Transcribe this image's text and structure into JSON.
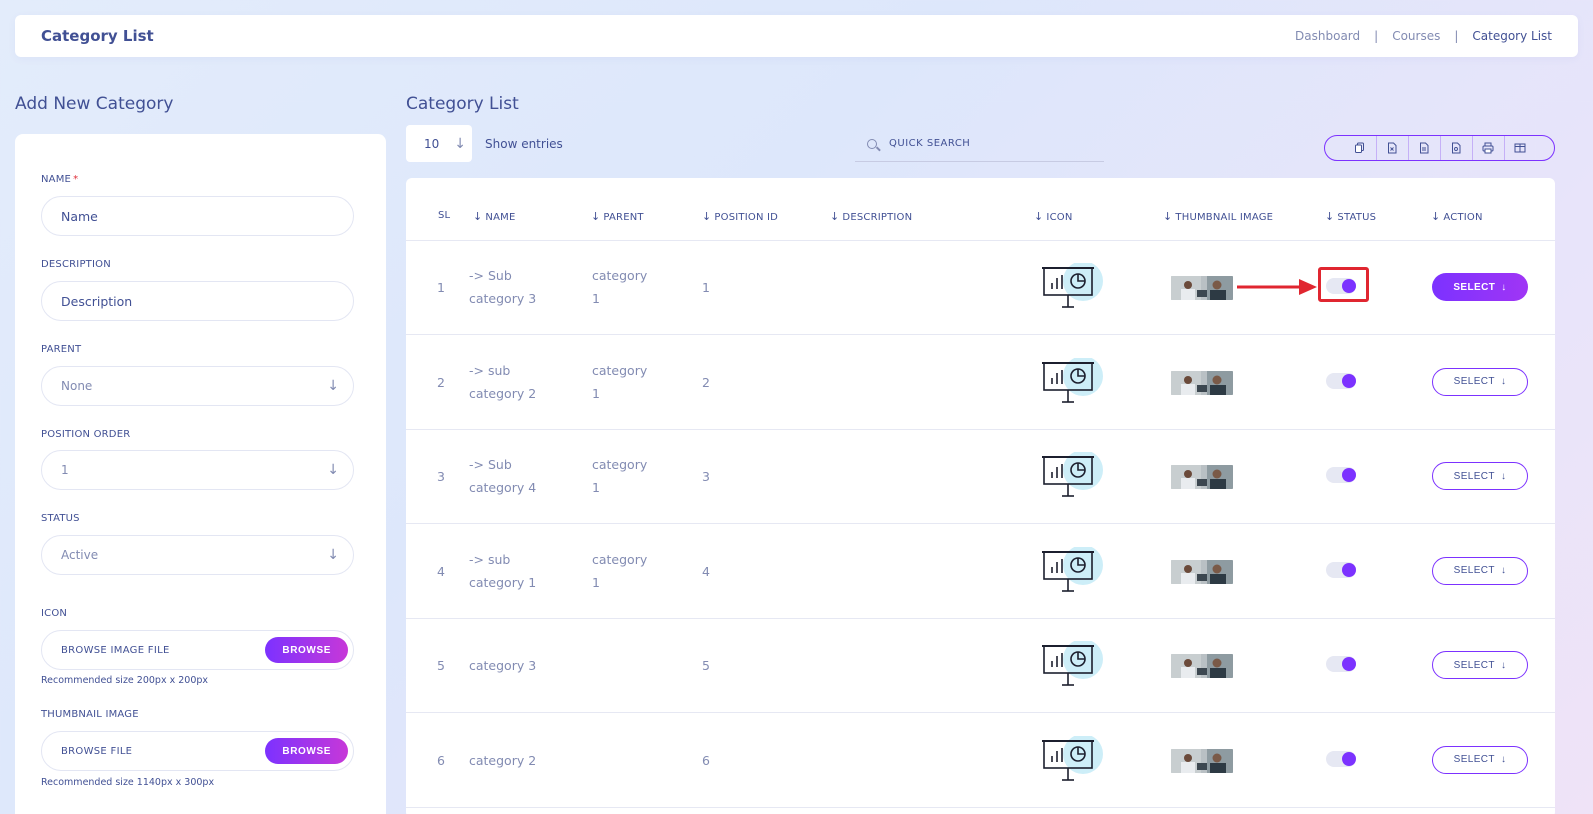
{
  "header": {
    "title": "Category List",
    "breadcrumb": [
      "Dashboard",
      "Courses",
      "Category List"
    ],
    "separator": "|"
  },
  "form": {
    "heading": "Add New Category",
    "name_label": "NAME",
    "name_required": "*",
    "name_placeholder": "Name",
    "description_label": "DESCRIPTION",
    "description_placeholder": "Description",
    "parent_label": "PARENT",
    "parent_value": "None",
    "position_label": "POSITION ORDER",
    "position_value": "1",
    "status_label": "STATUS",
    "status_value": "Active",
    "icon_label": "ICON",
    "icon_file_text": "BROWSE IMAGE FILE",
    "icon_browse": "BROWSE",
    "icon_hint": "Recommended size 200px x 200px",
    "thumb_label": "THUMBNAIL IMAGE",
    "thumb_file_text": "BROWSE FILE",
    "thumb_browse": "BROWSE",
    "thumb_hint": "Recommended size 1140px x 300px"
  },
  "list": {
    "heading": "Category List",
    "entries_value": "10",
    "entries_label": "Show entries",
    "search_placeholder": "QUICK SEARCH",
    "export_icons": [
      "copy-icon",
      "excel-icon",
      "csv-icon",
      "pdf-icon",
      "print-icon",
      "columns-icon"
    ],
    "columns": [
      "SL",
      "NAME",
      "PARENT",
      "POSITION ID",
      "DESCRIPTION",
      "ICON",
      "THUMBNAIL IMAGE",
      "STATUS",
      "ACTION"
    ],
    "rows": [
      {
        "sl": "1",
        "name1": "-> Sub",
        "name2": "category 3",
        "parent1": "category",
        "parent2": "1",
        "pos": "1",
        "desc": "",
        "action": "SELECT"
      },
      {
        "sl": "2",
        "name1": "-> sub",
        "name2": "category 2",
        "parent1": "category",
        "parent2": "1",
        "pos": "2",
        "desc": "",
        "action": "SELECT"
      },
      {
        "sl": "3",
        "name1": "-> Sub",
        "name2": "category 4",
        "parent1": "category",
        "parent2": "1",
        "pos": "3",
        "desc": "",
        "action": "SELECT"
      },
      {
        "sl": "4",
        "name1": "-> sub",
        "name2": "category 1",
        "parent1": "category",
        "parent2": "1",
        "pos": "4",
        "desc": "",
        "action": "SELECT"
      },
      {
        "sl": "5",
        "name1": "category 3",
        "name2": "",
        "parent1": "",
        "parent2": "",
        "pos": "5",
        "desc": "",
        "action": "SELECT"
      },
      {
        "sl": "6",
        "name1": "category 2",
        "name2": "",
        "parent1": "",
        "parent2": "",
        "pos": "6",
        "desc": "",
        "action": "SELECT"
      }
    ]
  },
  "colors": {
    "accent": "#7c32ff",
    "accent_end": "#c738d8",
    "text": "#415094",
    "muted": "#828bb2",
    "highlight": "#e02630"
  }
}
